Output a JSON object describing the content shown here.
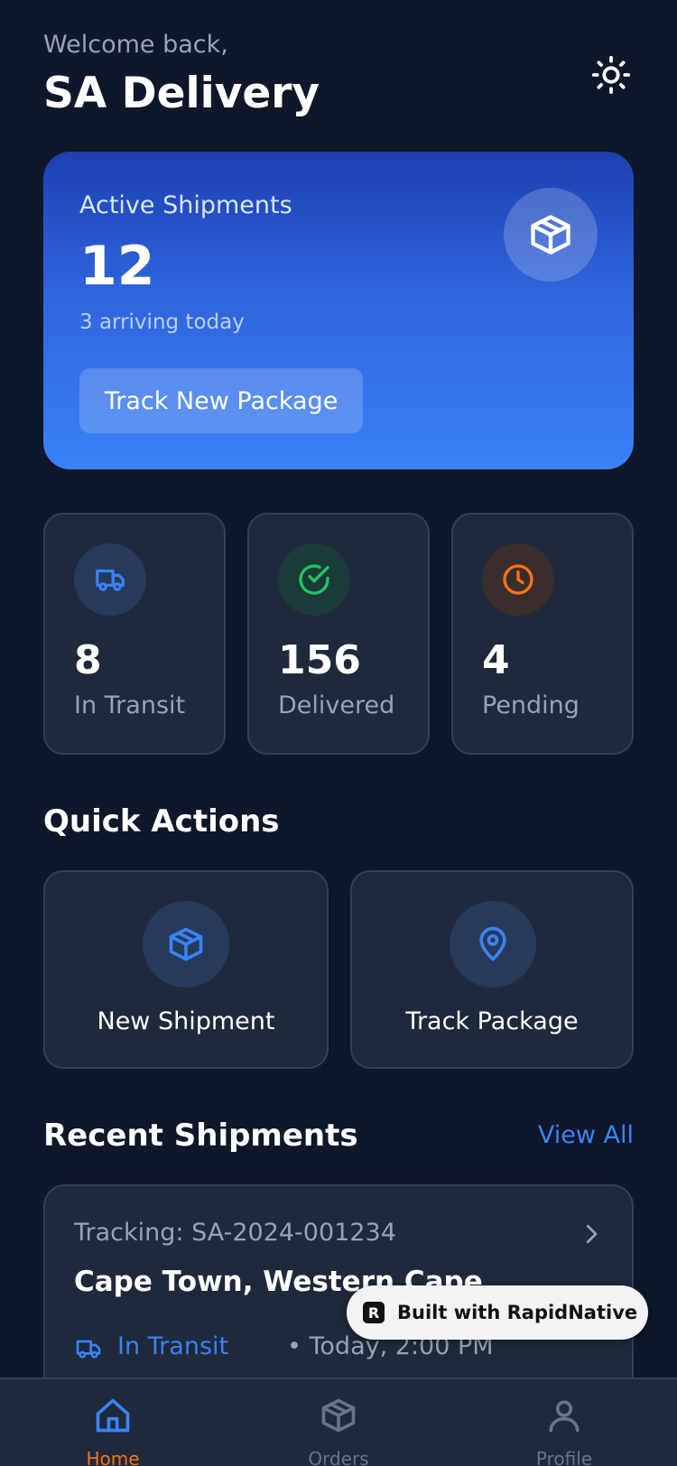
{
  "header": {
    "welcome": "Welcome back,",
    "brand": "SA Delivery",
    "theme_icon": "sun-icon"
  },
  "hero": {
    "label": "Active Shipments",
    "count": "12",
    "subtitle": "3 arriving today",
    "button_label": "Track New Package",
    "icon": "package-icon"
  },
  "stats": [
    {
      "value": "8",
      "label": "In Transit",
      "icon": "truck-icon",
      "color": "#3b82f6"
    },
    {
      "value": "156",
      "label": "Delivered",
      "icon": "check-circle-icon",
      "color": "#22c55e"
    },
    {
      "value": "4",
      "label": "Pending",
      "icon": "clock-icon",
      "color": "#f97316"
    }
  ],
  "quick_actions": {
    "title": "Quick Actions",
    "items": [
      {
        "label": "New Shipment",
        "icon": "package-icon"
      },
      {
        "label": "Track Package",
        "icon": "map-pin-icon"
      }
    ]
  },
  "recent": {
    "title": "Recent Shipments",
    "view_all": "View All",
    "shipments": [
      {
        "tracking": "Tracking: SA-2024-001234",
        "destination": "Cape Town, Western Cape",
        "status": "In Transit",
        "time": "• Today, 2:00 PM",
        "status_color": "#3b82f6"
      }
    ]
  },
  "badge": {
    "text": "Built with RapidNative"
  },
  "nav": {
    "items": [
      {
        "label": "Home",
        "icon": "home-icon",
        "active": true
      },
      {
        "label": "Orders",
        "icon": "package-icon",
        "active": false
      },
      {
        "label": "Profile",
        "icon": "user-icon",
        "active": false
      }
    ],
    "active_color": "#f97316",
    "active_icon_color": "#3b82f6",
    "inactive_color": "#6b7487"
  }
}
